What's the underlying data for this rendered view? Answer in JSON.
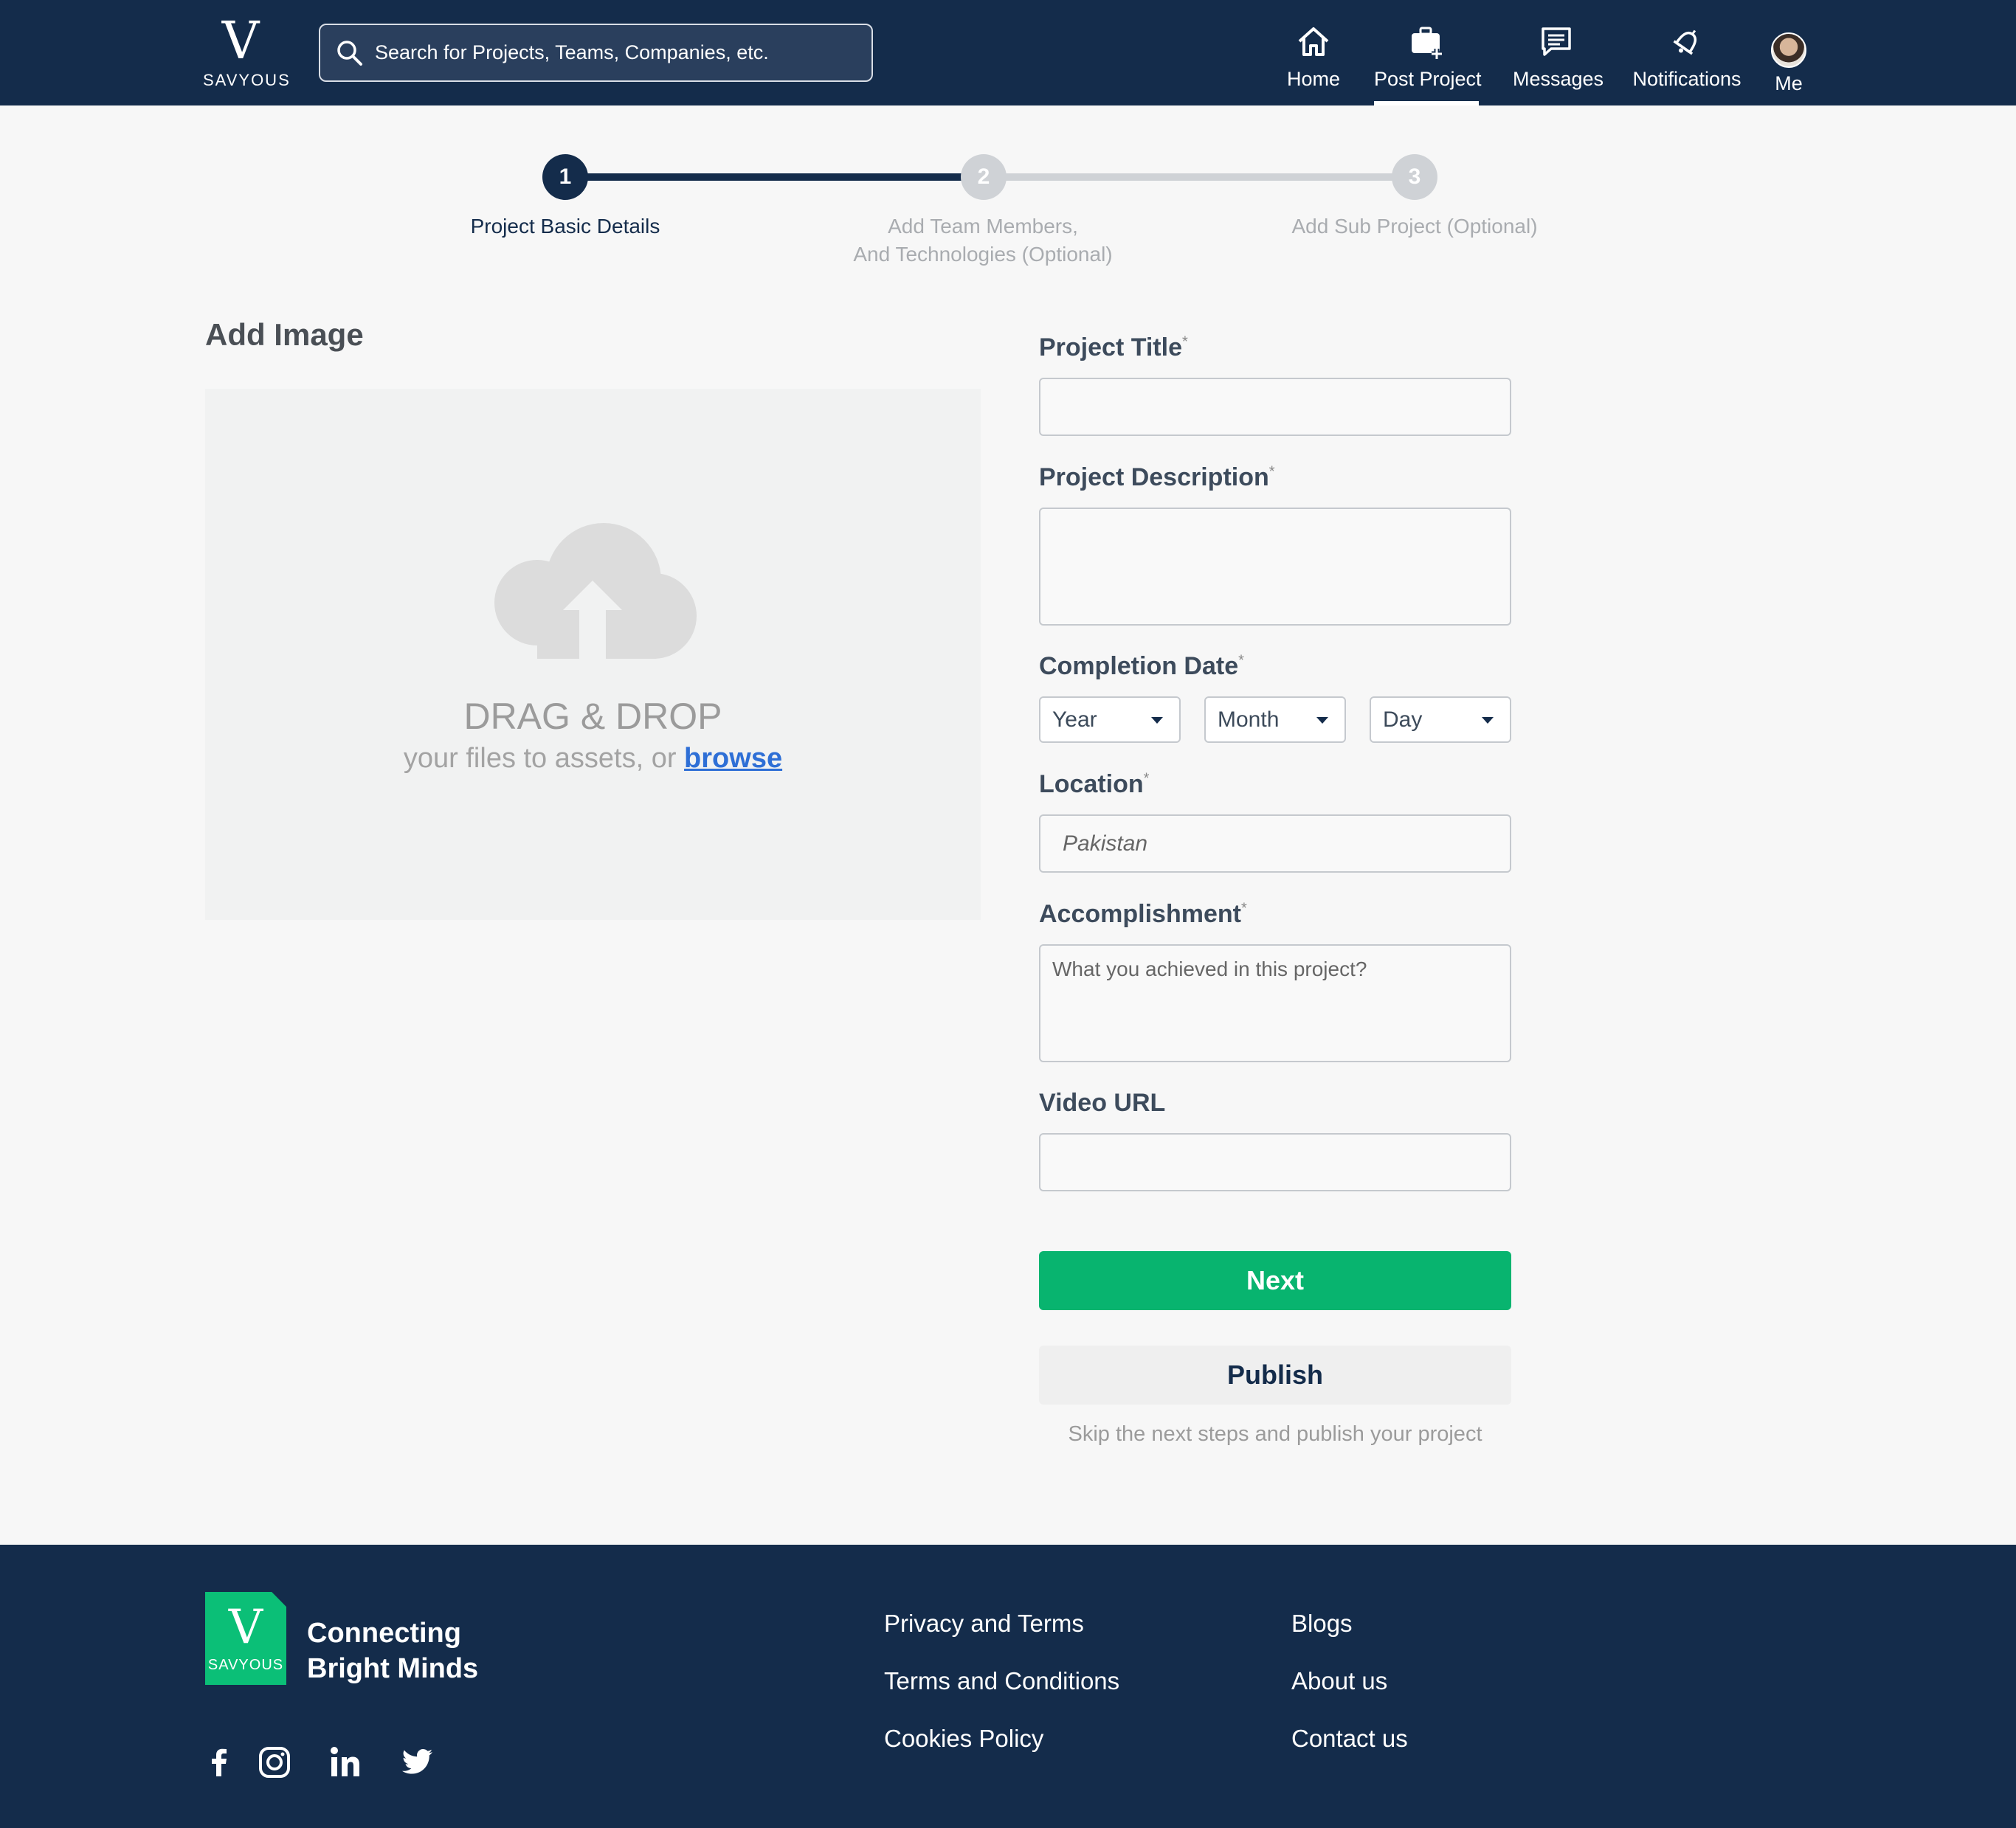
{
  "header": {
    "brand": "SAVYOUS",
    "search_placeholder": "Search for Projects, Teams, Companies, etc.",
    "nav": [
      {
        "label": "Home",
        "icon": "home-icon"
      },
      {
        "label": "Post Project",
        "icon": "briefcase-plus-icon",
        "active": true
      },
      {
        "label": "Messages",
        "icon": "message-icon"
      },
      {
        "label": "Notifications",
        "icon": "bell-icon"
      },
      {
        "label": "Me",
        "icon": "avatar"
      }
    ]
  },
  "stepper": {
    "steps": [
      {
        "number": "1",
        "label": "Project Basic Details",
        "state": "active"
      },
      {
        "number": "2",
        "label_line1": "Add Team Members,",
        "label_line2": "And Technologies (Optional)",
        "state": "inactive"
      },
      {
        "number": "3",
        "label": "Add Sub Project (Optional)",
        "state": "inactive"
      }
    ]
  },
  "image_upload": {
    "title": "Add Image",
    "drag_title": "DRAG & DROP",
    "drag_sub": "your files to assets, or",
    "browse_link": "browse"
  },
  "form": {
    "project_title": {
      "label": "Project Title",
      "required": "*",
      "value": ""
    },
    "project_description": {
      "label": "Project Description",
      "required": "*",
      "value": ""
    },
    "completion_date": {
      "label": "Completion Date",
      "required": "*",
      "year": "Year",
      "month": "Month",
      "day": "Day"
    },
    "location": {
      "label": "Location",
      "required": "*",
      "placeholder": "Pakistan"
    },
    "accomplishment": {
      "label": "Accomplishment",
      "required": "*",
      "placeholder": "What you achieved in this project?"
    },
    "video_url": {
      "label": "Video URL",
      "value": ""
    },
    "next_button": "Next",
    "publish_button": "Publish",
    "skip_note": "Skip the next steps and publish your project"
  },
  "footer": {
    "brand": "SAVYOUS",
    "tagline_line1": "Connecting",
    "tagline_line2": "Bright Minds",
    "social": [
      "facebook-icon",
      "instagram-icon",
      "linkedin-icon",
      "twitter-icon"
    ],
    "links_col1": [
      "Privacy and Terms",
      "Terms and Conditions",
      "Cookies Policy"
    ],
    "links_col2": [
      "Blogs",
      "About us",
      "Contact us"
    ]
  },
  "colors": {
    "navy": "#142c4b",
    "green": "#08b46f",
    "link_blue": "#2e6fd6",
    "inactive_step": "#cfd2d6"
  }
}
